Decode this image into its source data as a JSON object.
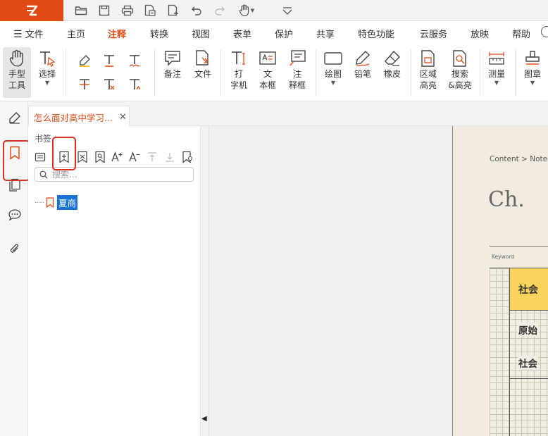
{
  "menubar": {
    "file": "文件",
    "items": [
      "主页",
      "注释",
      "转换",
      "视图",
      "表单",
      "保护",
      "共享",
      "特色功能",
      "云服务",
      "放映",
      "帮助"
    ],
    "active": "注释"
  },
  "ribbon": {
    "hand": "手型\n工具",
    "select": "选择",
    "note": "备注",
    "file": "文件",
    "typewriter": "打\n字机",
    "textbox": "文\n本框",
    "callout": "注\n释框",
    "drawing": "绘图",
    "pencil": "铅笔",
    "eraser": "橡皮",
    "area_highlight": "区域\n高亮",
    "search_highlight": "搜索\n&高亮",
    "measure": "测量",
    "stamp": "图章"
  },
  "document_tab": {
    "title": "怎么面对高中学习..."
  },
  "bookmark_panel": {
    "title": "书签",
    "search_placeholder": "搜索...",
    "items": [
      {
        "label": "夏商"
      }
    ]
  },
  "document": {
    "breadcrumb": "Content > Note",
    "heading": "Ch.",
    "keyword_label": "Keyword",
    "cells": [
      "社会",
      "原始",
      "社会"
    ]
  },
  "colors": {
    "accent": "#e04b15",
    "highlight_box": "#d93025",
    "selection": "#1a73d4",
    "yellow_cell": "#f9d35c"
  },
  "icons": [
    "app-logo-icon",
    "open-icon",
    "save-icon",
    "print-icon",
    "export-icon",
    "new-file-icon",
    "undo-icon",
    "redo-icon",
    "hand-icon",
    "customize-dropdown-icon",
    "more-icon",
    "bookmark-icon",
    "add-bookmark-icon",
    "comment-icon",
    "attachment-icon",
    "pages-icon",
    "pen-icon"
  ]
}
